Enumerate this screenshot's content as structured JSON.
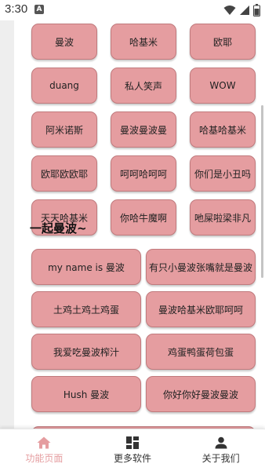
{
  "status_bar": {
    "time": "3:30",
    "notification_letter": "A"
  },
  "grid_top": [
    "曼波",
    "哈基米",
    "欧耶",
    "duang",
    "私人笑声",
    "WOW",
    "阿米诺斯",
    "曼波曼波曼",
    "哈基哈基米",
    "欧耶欧欧耶",
    "呵呵哈呵呵",
    "你们是小丑吗",
    "天天哈基米",
    "你哈牛魔啊",
    "吔屎啦梁非凡"
  ],
  "section": {
    "title": "一起曼波~"
  },
  "grid_bottom": [
    "my name is 曼波",
    "有只小曼波张嘴就是曼波",
    "土鸡土鸡土鸡蛋",
    "曼波哈基米欧耶呵呵",
    "我爱吃曼波榨汁",
    "鸡蛋鸭蛋荷包蛋",
    "Hush 曼波",
    "你好你好曼波曼波"
  ],
  "bottom_nav": [
    {
      "label": "功能页面",
      "icon": "home-icon",
      "active": true
    },
    {
      "label": "更多软件",
      "icon": "grid-icon",
      "active": false
    },
    {
      "label": "关于我们",
      "icon": "person-icon",
      "active": false
    }
  ],
  "colors": {
    "button_bg": "#e59da0",
    "accent": "#e59da0"
  }
}
